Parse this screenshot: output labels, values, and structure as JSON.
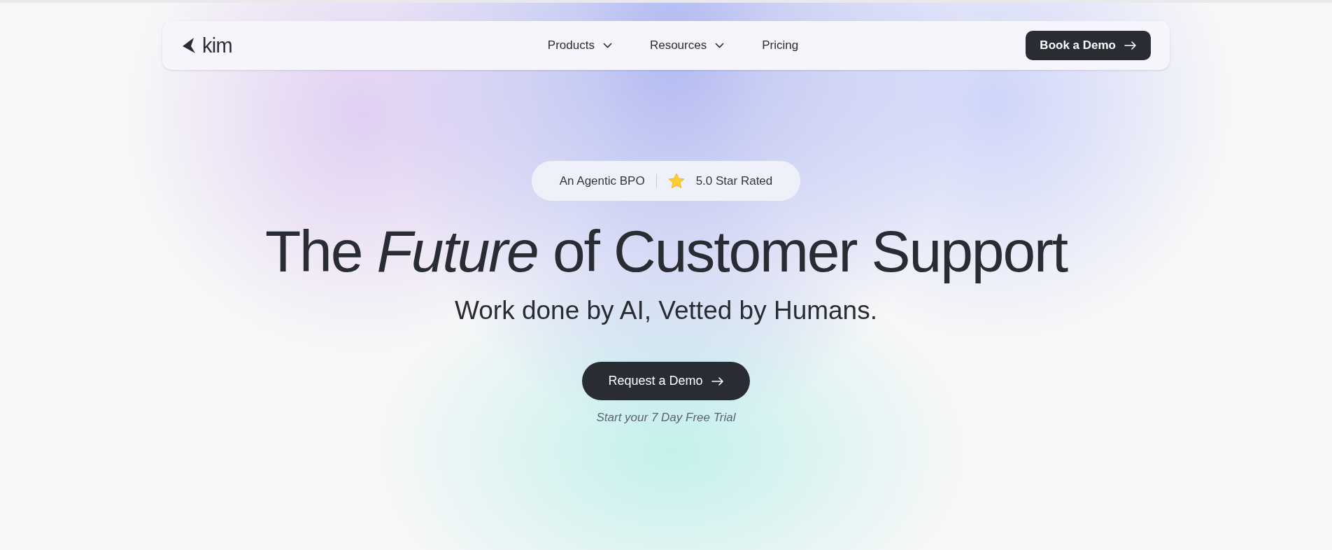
{
  "nav": {
    "logo": "kim",
    "items": [
      {
        "label": "Products",
        "has_menu": true
      },
      {
        "label": "Resources",
        "has_menu": true
      },
      {
        "label": "Pricing",
        "has_menu": false
      }
    ],
    "cta": "Book a Demo"
  },
  "hero": {
    "badge": {
      "left": "An Agentic BPO",
      "right": "5.0 Star Rated"
    },
    "headline": "The *Future* of Customer Support",
    "subtitle": "Work done by AI, Vetted by Humans.",
    "button": "Request a Demo",
    "note": "Start your 7 Day Free Trial"
  }
}
